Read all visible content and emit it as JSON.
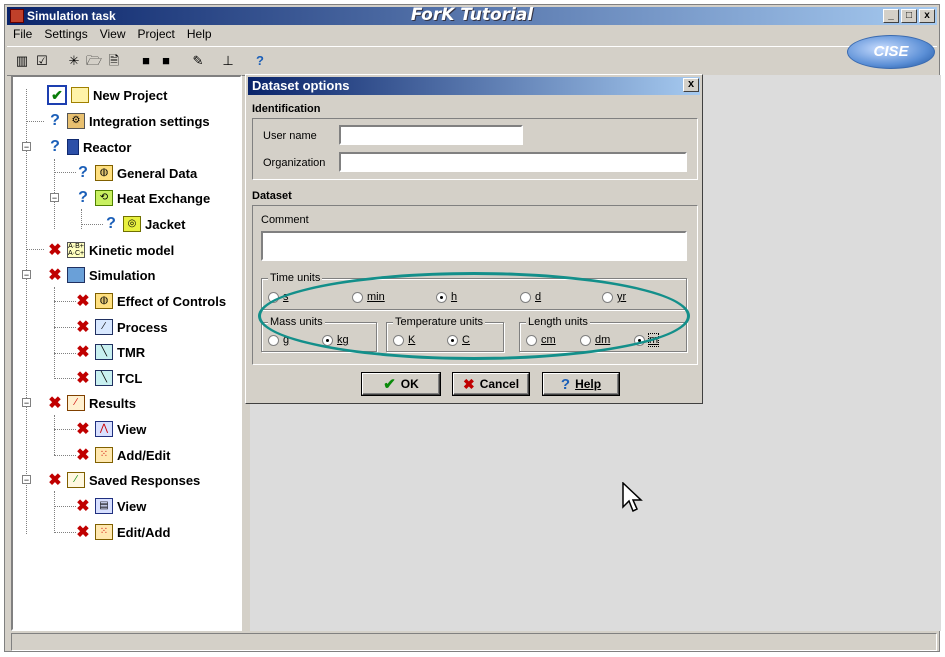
{
  "window": {
    "title": "Simulation task",
    "center_title": "ForK Tutorial",
    "buttons": [
      "_",
      "□",
      "x"
    ]
  },
  "menu": [
    "File",
    "Settings",
    "View",
    "Project",
    "Help"
  ],
  "logo_text": "CISE",
  "tree": [
    {
      "label": "New Project",
      "status": "ok"
    },
    {
      "label": "Integration settings",
      "status": "question"
    },
    {
      "label": "Reactor",
      "status": "question"
    },
    {
      "label": "General Data",
      "status": "question"
    },
    {
      "label": "Heat Exchange",
      "status": "question"
    },
    {
      "label": "Jacket",
      "status": "question"
    },
    {
      "label": "Kinetic model",
      "status": "error"
    },
    {
      "label": "Simulation",
      "status": "error"
    },
    {
      "label": "Effect of Controls",
      "status": "error"
    },
    {
      "label": "Process",
      "status": "error"
    },
    {
      "label": "TMR",
      "status": "error"
    },
    {
      "label": "TCL",
      "status": "error"
    },
    {
      "label": "Results",
      "status": "error"
    },
    {
      "label": "View",
      "status": "error"
    },
    {
      "label": "Add/Edit",
      "status": "error"
    },
    {
      "label": "Saved Responses",
      "status": "error"
    },
    {
      "label": "View",
      "status": "error"
    },
    {
      "label": "Edit/Add",
      "status": "error"
    }
  ],
  "dialog": {
    "title": "Dataset options",
    "close": "x",
    "identification": "Identification",
    "user_name_label": "User name",
    "user_name_value": "",
    "organization_label": "Organization",
    "organization_value": "",
    "dataset": "Dataset",
    "comment_label": "Comment",
    "comment_value": "",
    "time_units": {
      "label": "Time units",
      "options": [
        "s",
        "min",
        "h",
        "d",
        "yr"
      ],
      "selected": "h"
    },
    "mass_units": {
      "label": "Mass units",
      "options": [
        "g",
        "kg"
      ],
      "selected": "kg"
    },
    "temperature_units": {
      "label": "Temperature units",
      "options": [
        "K",
        "C"
      ],
      "selected": "C"
    },
    "length_units": {
      "label": "Length units",
      "options": [
        "cm",
        "dm",
        "m"
      ],
      "selected": "m"
    },
    "ok": "OK",
    "cancel": "Cancel",
    "help": "Help"
  }
}
